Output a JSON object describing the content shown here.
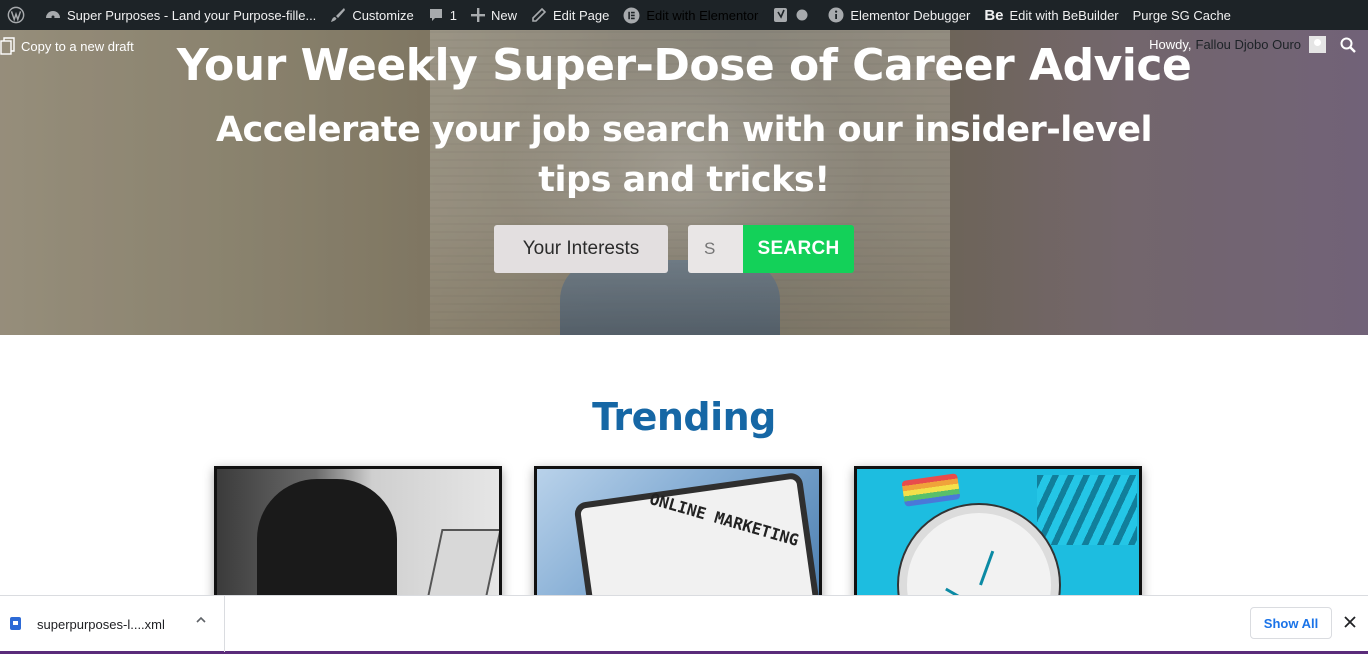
{
  "adminbar": {
    "site_title": "Super Purposes - Land your Purpose-fille...",
    "customize": "Customize",
    "comments_count": "1",
    "new_label": "New",
    "edit_page": "Edit Page",
    "edit_elementor": "Edit with Elementor",
    "elementor_debugger": "Elementor Debugger",
    "bebuilder_badge": "Be",
    "edit_bebuilder": "Edit with BeBuilder",
    "purge_cache": "Purge SG Cache"
  },
  "toolbar": {
    "copy_draft": "Copy to a new draft",
    "howdy": "Howdy,",
    "user_name": "Fallou Djobo Ouro"
  },
  "hero": {
    "title": "Your Weekly Super-Dose of Career Advice",
    "subtitle": "Accelerate your job search with our insider-level tips and tricks!",
    "interests_button": "Your Interests",
    "search_placeholder": "S",
    "search_button": "SEARCH"
  },
  "trending": {
    "title": "Trending",
    "cards": [
      {
        "image": "stressed-person-laptop"
      },
      {
        "image": "online-marketing-tablet",
        "image_text": "ONLINE MARKETING"
      },
      {
        "image": "clock-desk"
      }
    ]
  },
  "downloads": {
    "file_name": "superpurposes-l....xml",
    "show_all": "Show All"
  },
  "colors": {
    "admin_bar": "#1d2327",
    "trending_title": "#1667a5",
    "search_button": "#13d159",
    "show_all_text": "#1a73e8"
  }
}
